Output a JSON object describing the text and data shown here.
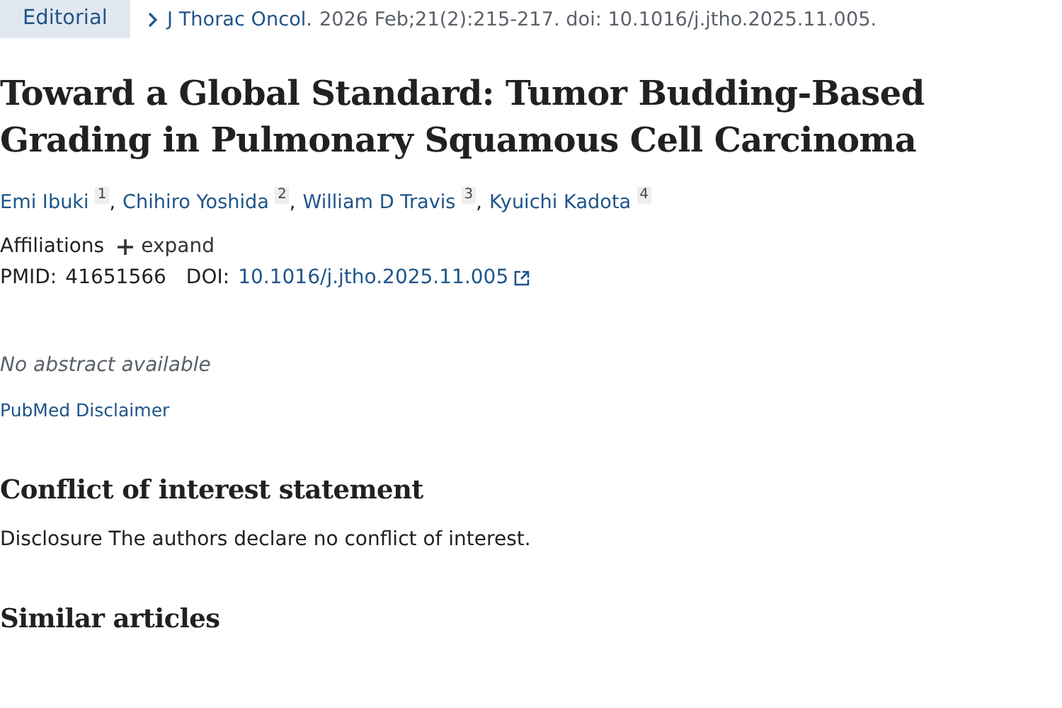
{
  "article_type": "Editorial",
  "citation": {
    "journal": "J Thorac Oncol.",
    "details": "2026 Feb;21(2):215-217. doi: 10.1016/j.jtho.2025.11.005."
  },
  "title": "Toward a Global Standard: Tumor Budding-Based Grading in Pulmonary Squamous Cell Carcinoma",
  "authors": [
    {
      "name": "Emi Ibuki",
      "affiliation": "1",
      "separator": ","
    },
    {
      "name": "Chihiro Yoshida",
      "affiliation": "2",
      "separator": ","
    },
    {
      "name": "William D Travis",
      "affiliation": "3",
      "separator": ","
    },
    {
      "name": "Kyuichi Kadota",
      "affiliation": "4"
    }
  ],
  "affiliations": {
    "label": "Affiliations",
    "toggle": "expand",
    "expanded": false
  },
  "ids": {
    "pmid_label": "PMID:",
    "pmid": "41651566",
    "doi_label": "DOI:",
    "doi": "10.1016/j.jtho.2025.11.005"
  },
  "abstract_note": "No abstract available",
  "disclaimer": "PubMed Disclaimer",
  "conflict": {
    "heading": "Conflict of interest statement",
    "text": "Disclosure The authors declare no conflict of interest."
  },
  "similar": {
    "heading": "Similar articles"
  }
}
